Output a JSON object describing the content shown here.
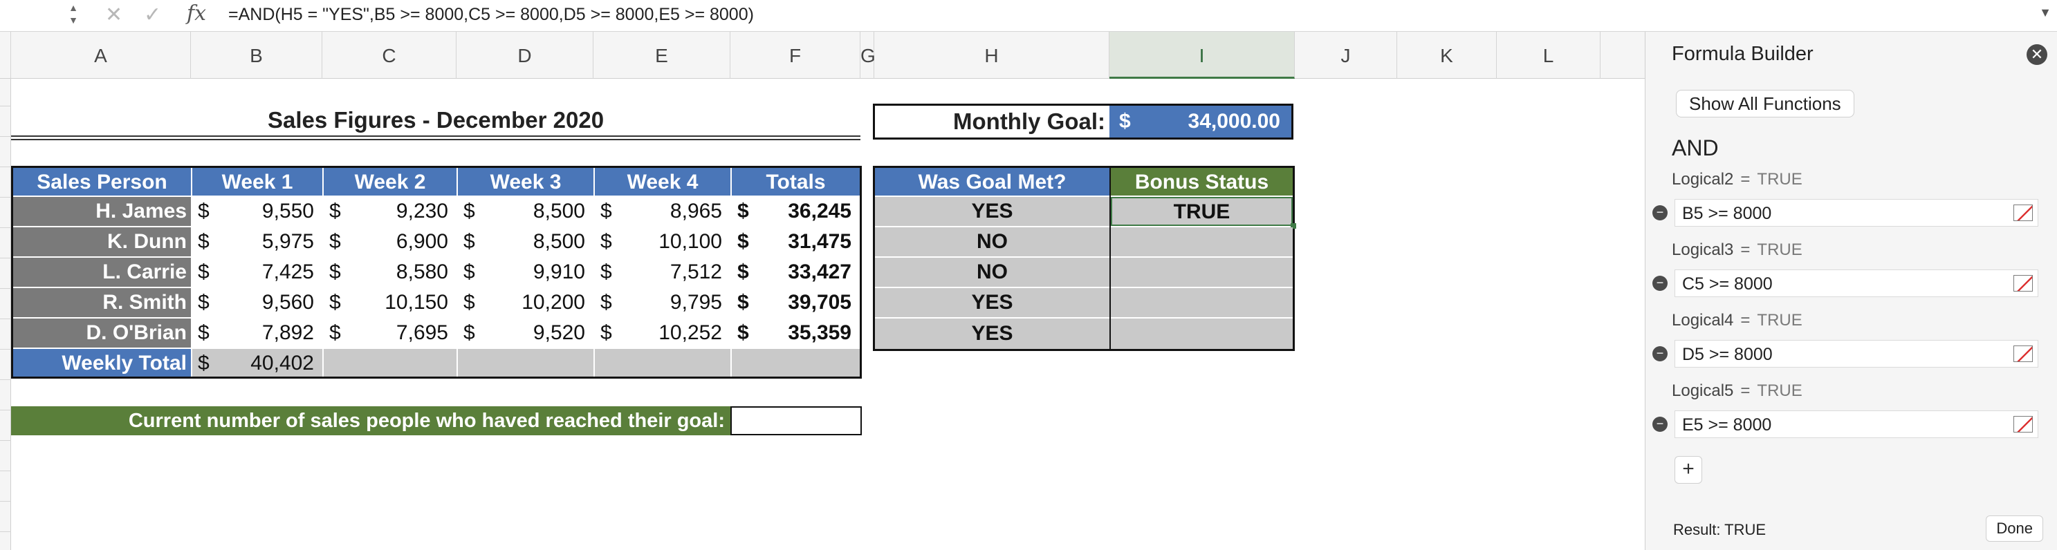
{
  "formula_bar": {
    "fx_label": "fx",
    "formula": "=AND(H5 = \"YES\",B5 >= 8000,C5 >= 8000,D5 >= 8000,E5 >= 8000)"
  },
  "columns": [
    "A",
    "B",
    "C",
    "D",
    "E",
    "F",
    "G",
    "H",
    "I",
    "J",
    "K",
    "L"
  ],
  "sheet": {
    "title": "Sales Figures - December 2020",
    "goal_label": "Monthly Goal:",
    "goal_currency": "$",
    "goal_value": "34,000.00",
    "headers": [
      "Sales Person",
      "Week 1",
      "Week 2",
      "Week 3",
      "Week 4",
      "Totals"
    ],
    "status_headers": [
      "Was Goal Met?",
      "Bonus Status"
    ],
    "currency": "$",
    "rows": [
      {
        "name": "H. James",
        "w1": "9,550",
        "w2": "9,230",
        "w3": "8,500",
        "w4": "8,965",
        "total": "36,245",
        "goal_met": "YES",
        "bonus": "TRUE"
      },
      {
        "name": "K. Dunn",
        "w1": "5,975",
        "w2": "6,900",
        "w3": "8,500",
        "w4": "10,100",
        "total": "31,475",
        "goal_met": "NO",
        "bonus": ""
      },
      {
        "name": "L. Carrie",
        "w1": "7,425",
        "w2": "8,580",
        "w3": "9,910",
        "w4": "7,512",
        "total": "33,427",
        "goal_met": "NO",
        "bonus": ""
      },
      {
        "name": "R. Smith",
        "w1": "9,560",
        "w2": "10,150",
        "w3": "10,200",
        "w4": "9,795",
        "total": "39,705",
        "goal_met": "YES",
        "bonus": ""
      },
      {
        "name": "D. O'Brian",
        "w1": "7,892",
        "w2": "7,695",
        "w3": "9,520",
        "w4": "10,252",
        "total": "35,359",
        "goal_met": "YES",
        "bonus": ""
      }
    ],
    "weekly_total_label": "Weekly Total",
    "weekly_total_w1": "40,402",
    "reached_goal_label": "Current number of sales people who haved reached their goal:"
  },
  "formula_builder": {
    "title": "Formula Builder",
    "show_all_label": "Show All Functions",
    "function_name": "AND",
    "args": [
      {
        "label": "Logical2",
        "result": "TRUE",
        "value": "B5 >= 8000"
      },
      {
        "label": "Logical3",
        "result": "TRUE",
        "value": "C5 >= 8000"
      },
      {
        "label": "Logical4",
        "result": "TRUE",
        "value": "D5 >= 8000"
      },
      {
        "label": "Logical5",
        "result": "TRUE",
        "value": "E5 >= 8000"
      }
    ],
    "result_label": "Result: TRUE",
    "done_label": "Done"
  },
  "colors": {
    "header_blue": "#4a76b8",
    "header_green": "#5a7f3a",
    "name_gray": "#7a7a7a",
    "cell_gray": "#c9c9c9"
  }
}
